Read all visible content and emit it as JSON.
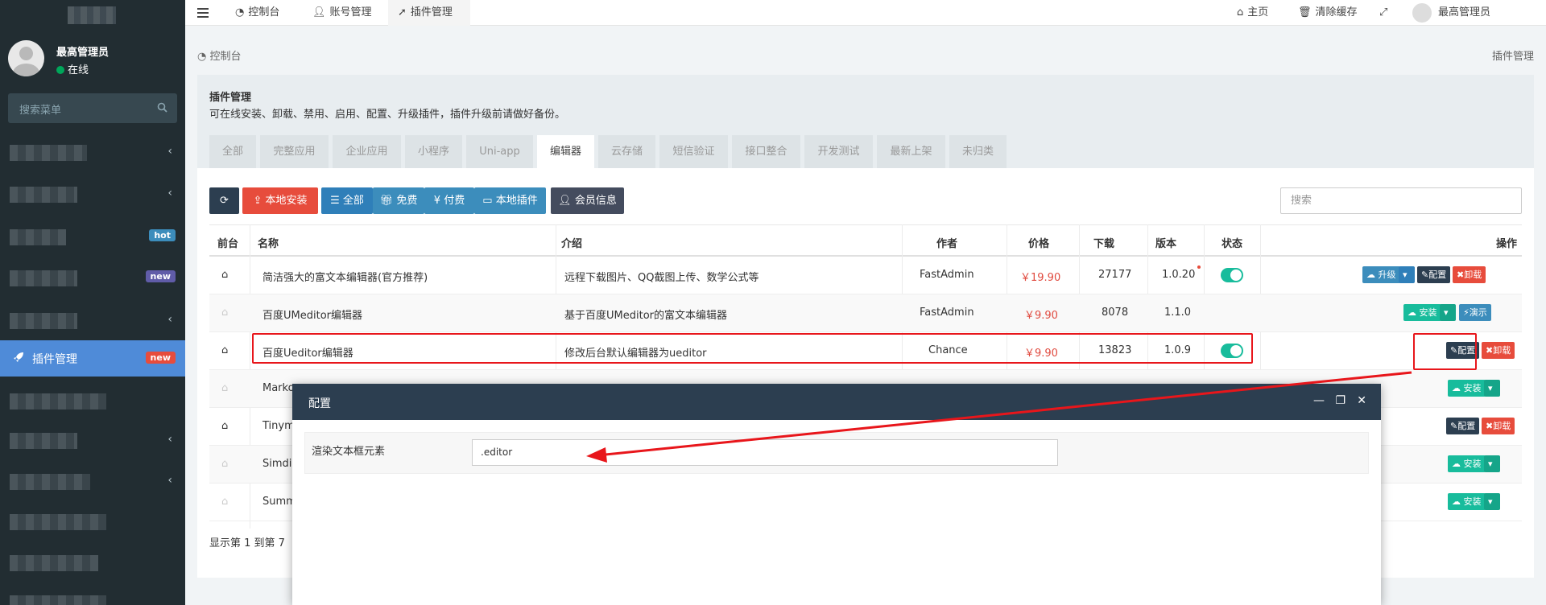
{
  "sidebar": {
    "user_name": "最高管理员",
    "user_status": "在线",
    "search_placeholder": "搜索菜单",
    "badge_hot": "hot",
    "badge_new": "new",
    "active_item": "插件管理",
    "active_badge": "new"
  },
  "topbar": {
    "menu_icon": "hamburger-icon",
    "tabs": [
      "控制台",
      "账号管理",
      "插件管理"
    ],
    "home": "主页",
    "clear_cache": "清除缓存",
    "user": "最高管理员"
  },
  "breadcrumb": {
    "left": "控制台",
    "right": "插件管理"
  },
  "panel": {
    "title": "插件管理",
    "description": "可在线安装、卸载、禁用、启用、配置、升级插件，插件升级前请做好备份。",
    "tabs": [
      "全部",
      "完整应用",
      "企业应用",
      "小程序",
      "Uni-app",
      "编辑器",
      "云存储",
      "短信验证",
      "接口整合",
      "开发测试",
      "最新上架",
      "未归类"
    ],
    "active_tab": "编辑器"
  },
  "toolbar": {
    "local_install": "本地安装",
    "all": "全部",
    "free": "免费",
    "paid": "付费",
    "local_plugins": "本地插件",
    "member_info": "会员信息",
    "search_placeholder": "搜索"
  },
  "table": {
    "headers": [
      "前台",
      "名称",
      "介绍",
      "作者",
      "价格",
      "下载",
      "版本",
      "状态",
      "操作"
    ],
    "rows": [
      {
        "name": "简洁强大的富文本编辑器(官方推荐)",
        "intro": "远程下载图片、QQ截图上传、数学公式等",
        "author": "FastAdmin",
        "price": "￥19.90",
        "downloads": "27177",
        "version": "1.0.20"
      },
      {
        "name": "百度UMeditor编辑器",
        "intro": "基于百度UMeditor的富文本编辑器",
        "author": "FastAdmin",
        "price": "￥9.90",
        "downloads": "8078",
        "version": "1.1.0"
      },
      {
        "name": "百度Ueditor编辑器",
        "intro": "修改后台默认编辑器为ueditor",
        "author": "Chance",
        "price": "￥9.90",
        "downloads": "13823",
        "version": "1.0.9"
      },
      {
        "name": "Marko",
        "intro": "",
        "author": "",
        "price": "",
        "downloads": "",
        "version": ""
      },
      {
        "name": "Tinym",
        "intro": "",
        "author": "",
        "price": "",
        "downloads": "",
        "version": ""
      },
      {
        "name": "Simdi",
        "intro": "",
        "author": "",
        "price": "",
        "downloads": "",
        "version": ""
      },
      {
        "name": "Summ",
        "intro": "",
        "author": "",
        "price": "",
        "downloads": "",
        "version": ""
      }
    ],
    "actions": {
      "upgrade": "升级",
      "config": "配置",
      "uninstall": "卸载",
      "install": "安装",
      "demo": "演示"
    },
    "footer": "显示第 1 到第 7"
  },
  "modal": {
    "title": "配置",
    "field_label": "渲染文本框元素",
    "field_value": ".editor"
  },
  "colors": {
    "sidebar_bg": "#222d32",
    "active_menu": "#4f8bd8",
    "primary": "#2c3e50",
    "info": "#3c8dbc",
    "success": "#18bc9c",
    "danger": "#e74c3c",
    "annotation_red": "#e8161b"
  }
}
